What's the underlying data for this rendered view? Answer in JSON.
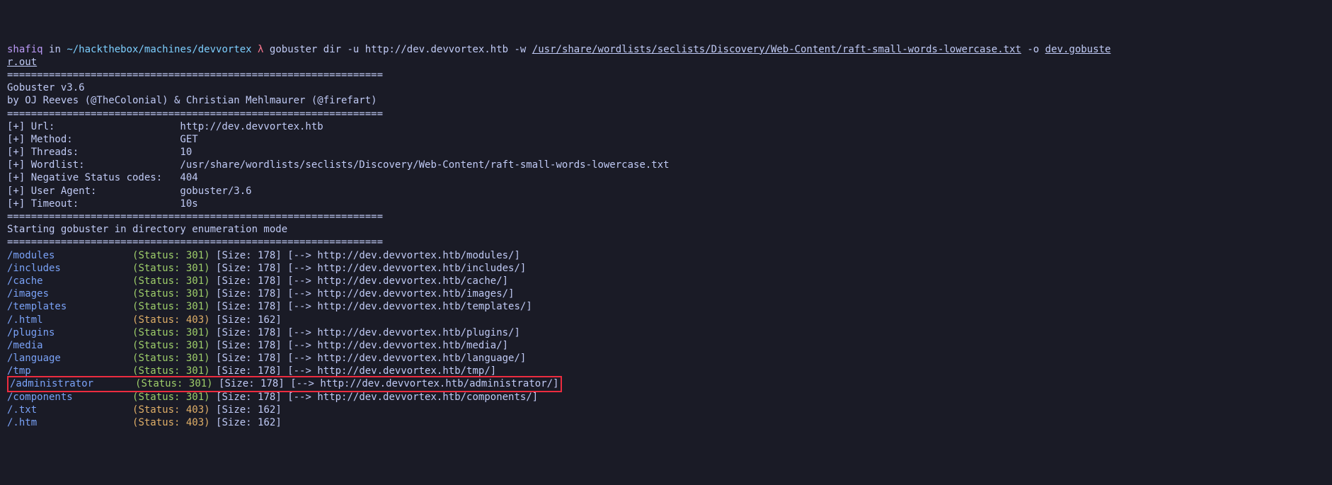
{
  "prompt": {
    "user": "shafiq",
    "in": "in",
    "path": "~/hackthebox/machines/devvortex",
    "symbol": "λ",
    "cmd_prefix": "gobuster dir -u http://dev.devvortex.htb -w ",
    "wordlist": "/usr/share/wordlists/seclists/Discovery/Web-Content/raft-small-words-lowercase.txt",
    "cmd_mid": " -o ",
    "outfile1": "dev.gobuste",
    "outfile2": "r.out"
  },
  "hr": "===============================================================",
  "banner_line1": "Gobuster v3.6",
  "banner_line2": "by OJ Reeves (@TheColonial) & Christian Mehlmaurer (@firefart)",
  "config": [
    {
      "label": "[+] Url:                     ",
      "value": "http://dev.devvortex.htb"
    },
    {
      "label": "[+] Method:                  ",
      "value": "GET"
    },
    {
      "label": "[+] Threads:                 ",
      "value": "10"
    },
    {
      "label": "[+] Wordlist:                ",
      "value": "/usr/share/wordlists/seclists/Discovery/Web-Content/raft-small-words-lowercase.txt"
    },
    {
      "label": "[+] Negative Status codes:   ",
      "value": "404"
    },
    {
      "label": "[+] User Agent:              ",
      "value": "gobuster/3.6"
    },
    {
      "label": "[+] Timeout:                 ",
      "value": "10s"
    }
  ],
  "starting": "Starting gobuster in directory enumeration mode",
  "results": [
    {
      "path": "/modules",
      "pad": "             ",
      "status": "301",
      "class": "green",
      "size": "178",
      "redirect": "http://dev.devvortex.htb/modules/",
      "highlight": false
    },
    {
      "path": "/includes",
      "pad": "            ",
      "status": "301",
      "class": "green",
      "size": "178",
      "redirect": "http://dev.devvortex.htb/includes/",
      "highlight": false
    },
    {
      "path": "/cache",
      "pad": "               ",
      "status": "301",
      "class": "green",
      "size": "178",
      "redirect": "http://dev.devvortex.htb/cache/",
      "highlight": false
    },
    {
      "path": "/images",
      "pad": "              ",
      "status": "301",
      "class": "green",
      "size": "178",
      "redirect": "http://dev.devvortex.htb/images/",
      "highlight": false
    },
    {
      "path": "/templates",
      "pad": "           ",
      "status": "301",
      "class": "green",
      "size": "178",
      "redirect": "http://dev.devvortex.htb/templates/",
      "highlight": false
    },
    {
      "path": "/.html",
      "pad": "               ",
      "status": "403",
      "class": "yellow",
      "size": "162",
      "redirect": null,
      "highlight": false
    },
    {
      "path": "/plugins",
      "pad": "             ",
      "status": "301",
      "class": "green",
      "size": "178",
      "redirect": "http://dev.devvortex.htb/plugins/",
      "highlight": false
    },
    {
      "path": "/media",
      "pad": "               ",
      "status": "301",
      "class": "green",
      "size": "178",
      "redirect": "http://dev.devvortex.htb/media/",
      "highlight": false
    },
    {
      "path": "/language",
      "pad": "            ",
      "status": "301",
      "class": "green",
      "size": "178",
      "redirect": "http://dev.devvortex.htb/language/",
      "highlight": false
    },
    {
      "path": "/tmp",
      "pad": "                 ",
      "status": "301",
      "class": "green",
      "size": "178",
      "redirect": "http://dev.devvortex.htb/tmp/",
      "highlight": false
    },
    {
      "path": "/administrator",
      "pad": "       ",
      "status": "301",
      "class": "green",
      "size": "178",
      "redirect": "http://dev.devvortex.htb/administrator/",
      "highlight": true
    },
    {
      "path": "/components",
      "pad": "          ",
      "status": "301",
      "class": "green",
      "size": "178",
      "redirect": "http://dev.devvortex.htb/components/",
      "highlight": false
    },
    {
      "path": "/.txt",
      "pad": "                ",
      "status": "403",
      "class": "yellow",
      "size": "162",
      "redirect": null,
      "highlight": false
    },
    {
      "path": "/.htm",
      "pad": "                ",
      "status": "403",
      "class": "yellow",
      "size": "162",
      "redirect": null,
      "highlight": false
    }
  ]
}
